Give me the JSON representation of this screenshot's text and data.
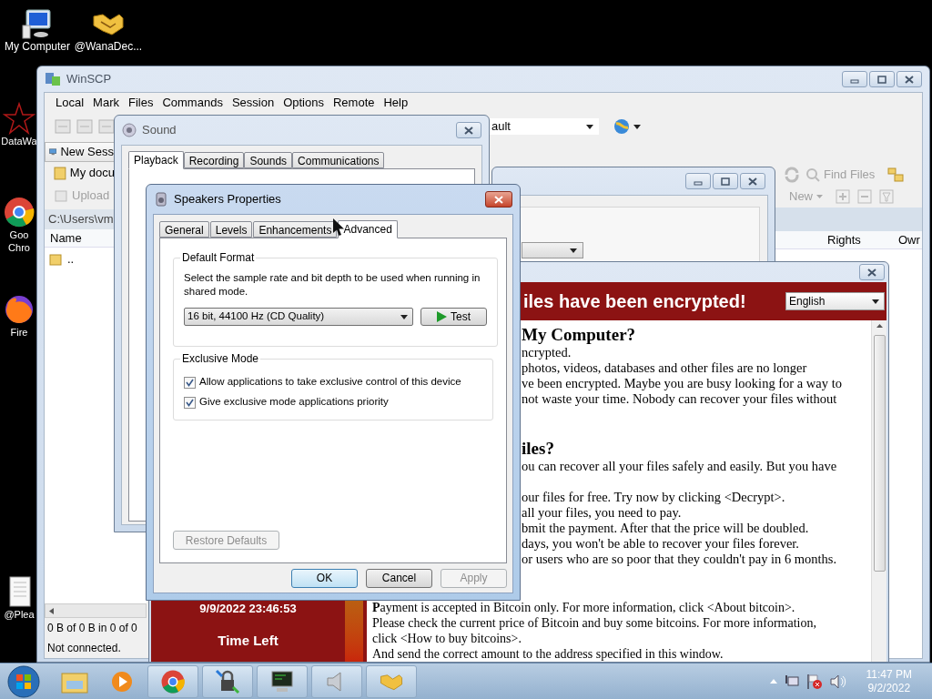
{
  "desktop": {
    "icons": [
      {
        "kind": "computer",
        "lines": [
          "My Computer"
        ]
      },
      {
        "kind": "handshake",
        "lines": [
          "@WanaDec..."
        ]
      },
      {
        "kind": "star",
        "lines": [
          "DataWa"
        ]
      },
      {
        "kind": "chrome",
        "lines": [
          "Goo",
          "Chro"
        ]
      },
      {
        "kind": "firefox",
        "lines": [
          "Fire"
        ]
      },
      {
        "kind": "document",
        "lines": [
          "@Plea"
        ]
      }
    ]
  },
  "winscp": {
    "title": "WinSCP",
    "menu": [
      "Local",
      "Mark",
      "Files",
      "Commands",
      "Session",
      "Options",
      "Remote",
      "Help"
    ],
    "session_combo": "ault",
    "tab": "New Sess",
    "local_location": "My docu",
    "upload": {
      "label": "Upload",
      "disabled": true
    },
    "path": "C:\\Users\\vm",
    "local_columns": [
      "Name"
    ],
    "local_rows": [
      ".."
    ],
    "status": [
      "0 B of 0 B in 0 of 0",
      "Not connected."
    ],
    "find_files": {
      "label": "Find Files",
      "disabled": true
    },
    "new_menu": {
      "label": "New",
      "disabled": true
    },
    "remote_columns": [
      "Rights",
      "Owr"
    ]
  },
  "sound": {
    "title": "Sound",
    "tabs": [
      {
        "label": "Playback",
        "selected": true
      },
      {
        "label": "Recording",
        "selected": false
      },
      {
        "label": "Sounds",
        "selected": false
      },
      {
        "label": "Communications",
        "selected": false
      }
    ]
  },
  "speakers": {
    "title": "Speakers Properties",
    "tabs": [
      {
        "label": "General",
        "selected": false
      },
      {
        "label": "Levels",
        "selected": false
      },
      {
        "label": "Enhancements",
        "selected": false
      },
      {
        "label": "Advanced",
        "selected": true
      }
    ],
    "default_format": {
      "legend": "Default Format",
      "description": "Select the sample rate and bit depth to be used when running in shared mode.",
      "format": "16 bit, 44100 Hz (CD Quality)",
      "test": "Test"
    },
    "exclusive_mode": {
      "legend": "Exclusive Mode",
      "options": [
        {
          "label": "Allow applications to take exclusive control of this device",
          "checked": true
        },
        {
          "label": "Give exclusive mode applications priority",
          "checked": true
        }
      ]
    },
    "restore": {
      "label": "Restore Defaults",
      "disabled": true
    },
    "buttons": [
      {
        "label": "OK",
        "default": true,
        "disabled": false
      },
      {
        "label": "Cancel",
        "default": false,
        "disabled": false
      },
      {
        "label": "Apply",
        "default": false,
        "disabled": true
      }
    ]
  },
  "ransom": {
    "banner": "iles have been encrypted!",
    "language": "English",
    "deadline": "9/9/2022 23:46:53",
    "time_left": "Time Left",
    "sections": [
      {
        "heading": "My Computer?",
        "paragraphs": [
          [
            "ncrypted.",
            "photos, videos, databases and other files are no longer",
            "ve been encrypted. Maybe you are busy looking for a way to",
            "not waste your time. Nobody can recover your files without"
          ]
        ]
      },
      {
        "heading": "iles?",
        "paragraphs": [
          [
            "ou can recover all your files safely and easily. But you have"
          ],
          [
            "our files for free. Try now by clicking <Decrypt>.",
            "all your files, you need to pay.",
            "bmit the payment. After that the price will be doubled.",
            "days, you won't be able to recover your files forever.",
            "or users who are so poor that they couldn't pay in 6 months."
          ]
        ]
      }
    ],
    "payment_lines": [
      "**P**ayment is accepted in Bitcoin only. For more information, click <About bitcoin>.",
      "Please check the current price of Bitcoin and buy some bitcoins. For more information,",
      "click <How to buy bitcoins>.",
      "And send the correct amount to the address specified in this window."
    ]
  },
  "tray": {
    "time": "11:47 PM",
    "date": "9/2/2022"
  }
}
